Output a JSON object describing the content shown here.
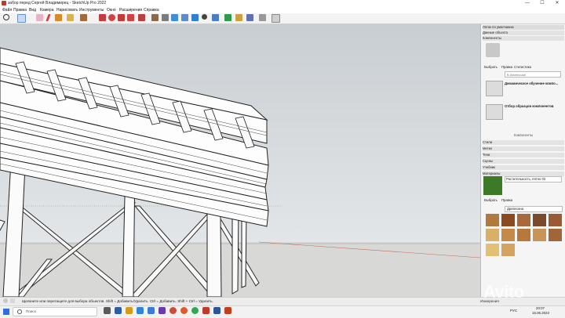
{
  "window": {
    "title": "забор перед Сергей Владимирец - SketchUp Pro 2022",
    "minimize": "—",
    "maximize": "☐",
    "close": "✕"
  },
  "menu": [
    "Файл",
    "Правка",
    "Вид",
    "Камера",
    "Нарисовать",
    "Инструменты",
    "Окно",
    "Расширения",
    "Справка"
  ],
  "tray": {
    "title": "Лоток по умолчанию",
    "entity_info": "Данные объекта",
    "components": "Компоненты",
    "tabs_comp": [
      "Выбрать",
      "Правка",
      "Статистика"
    ],
    "search_placeholder": "В Warehouse",
    "items": [
      {
        "label": "Динамическое обучение компо..."
      },
      {
        "label": "Отбор образцов компонентов"
      }
    ],
    "components_footer": "Компоненты",
    "panels": [
      "Стили",
      "Метки",
      "Тени",
      "Сцены",
      "Учебник",
      "Материалы"
    ],
    "material_name": "Растительность, пятно 03",
    "tabs_mat": [
      "Выбрать",
      "Правка"
    ],
    "library": "Древесина"
  },
  "status": {
    "text": "Щелкните или перетащите для выбора объектов. Shift = Добавить/Удалить. Ctrl = Добавить. Shift + Ctrl = Удалить.",
    "measure": "Измерения"
  },
  "taskbar": {
    "search": "Поиск",
    "lang": "РУС",
    "time": "20:07",
    "date": "16.06.2023"
  },
  "watermark": "Avito",
  "colors": {
    "accent": "#2d6fdc",
    "sketchup_red": "#c0392b"
  }
}
